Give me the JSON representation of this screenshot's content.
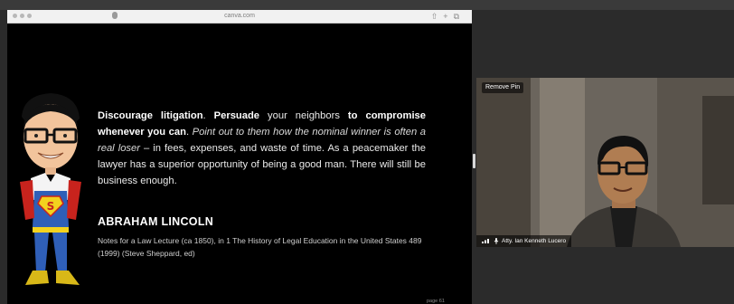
{
  "browser": {
    "url": "canva.com"
  },
  "slide": {
    "quote": {
      "bold1": "Discourage litigation",
      "plain1": ". ",
      "bold2": "Persuade",
      "plain2": " your neighbors ",
      "bold3": "to compromise whenever you can",
      "plain3": ". ",
      "italic1": "Point out to them how the nominal winner is often a real loser",
      "plain4": " – in fees, expenses, and waste of time. As a peacemaker the lawyer has a superior opportunity of being a good man. There will still be business enough."
    },
    "author": "ABRAHAM LINCOLN",
    "source": "Notes for a Law Lecture (ca 1850), in 1 The History of Legal Education in the United States 489 (1999) (Steve Sheppard, ed)",
    "page_number": "page 61",
    "caricature_icon": "superhero-caricature"
  },
  "video": {
    "pin_button": "Remove Pin",
    "participant_name": "Atty. Ian Kenneth Lucero",
    "signal_icon": "signal-bars-icon",
    "mic_icon": "microphone-icon"
  }
}
